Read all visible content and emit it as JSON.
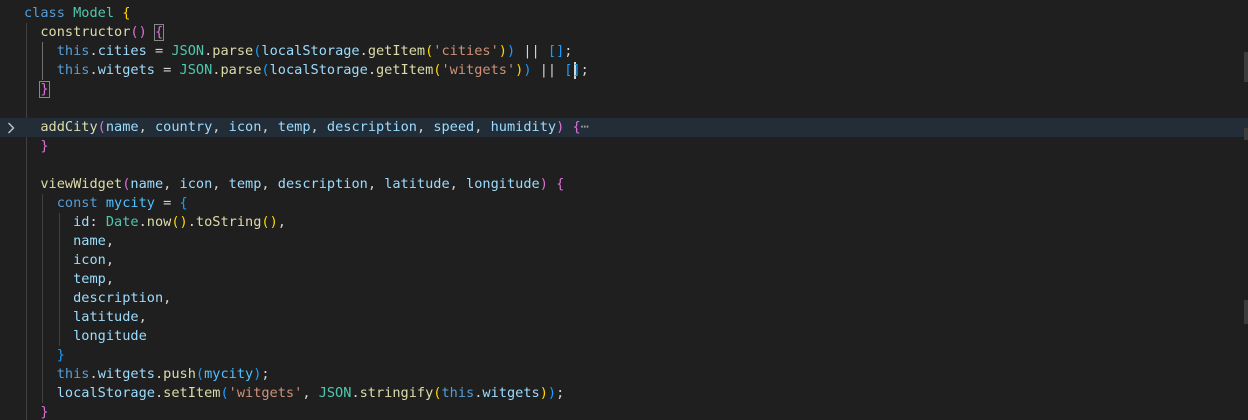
{
  "editor": {
    "colors": {
      "background": "#1f1f1f",
      "current_line": "#232d38",
      "keyword": "#569cd6",
      "class_name": "#4ec9b0",
      "function": "#dcdcaa",
      "variable": "#9cdcfe",
      "string": "#ce9178",
      "text": "#d4d4d4",
      "bracket_gold": "#ffd700",
      "bracket_pink": "#da70d6",
      "bracket_blue": "#179fff"
    },
    "fold_icon": "chevron-right-icon",
    "lines": [
      [
        [
          "class",
          "#569cd6"
        ],
        [
          " ",
          "#d4d4d4"
        ],
        [
          "Model",
          "#4ec9b0"
        ],
        [
          " ",
          "#d4d4d4"
        ],
        [
          "{",
          "#ffd700"
        ]
      ],
      [
        [
          "  ",
          "#d4d4d4"
        ],
        [
          "constructor",
          "#dcdcaa"
        ],
        [
          "()",
          "#da70d6"
        ],
        [
          " ",
          "#d4d4d4"
        ],
        [
          "{",
          "#da70d6"
        ]
      ],
      [
        [
          "    ",
          "#d4d4d4"
        ],
        [
          "this",
          "#569cd6"
        ],
        [
          ".",
          "#d4d4d4"
        ],
        [
          "cities",
          "#9cdcfe"
        ],
        [
          " = ",
          "#d4d4d4"
        ],
        [
          "JSON",
          "#4ec9b0"
        ],
        [
          ".",
          "#d4d4d4"
        ],
        [
          "parse",
          "#dcdcaa"
        ],
        [
          "(",
          "#179fff"
        ],
        [
          "localStorage",
          "#9cdcfe"
        ],
        [
          ".",
          "#d4d4d4"
        ],
        [
          "getItem",
          "#dcdcaa"
        ],
        [
          "(",
          "#ffd700"
        ],
        [
          "'cities'",
          "#ce9178"
        ],
        [
          ")",
          "#ffd700"
        ],
        [
          ")",
          "#179fff"
        ],
        [
          " || ",
          "#d4d4d4"
        ],
        [
          "[]",
          "#179fff"
        ],
        [
          ";",
          "#d4d4d4"
        ]
      ],
      [
        [
          "    ",
          "#d4d4d4"
        ],
        [
          "this",
          "#569cd6"
        ],
        [
          ".",
          "#d4d4d4"
        ],
        [
          "witgets",
          "#9cdcfe"
        ],
        [
          " = ",
          "#d4d4d4"
        ],
        [
          "JSON",
          "#4ec9b0"
        ],
        [
          ".",
          "#d4d4d4"
        ],
        [
          "parse",
          "#dcdcaa"
        ],
        [
          "(",
          "#179fff"
        ],
        [
          "localStorage",
          "#9cdcfe"
        ],
        [
          ".",
          "#d4d4d4"
        ],
        [
          "getItem",
          "#dcdcaa"
        ],
        [
          "(",
          "#ffd700"
        ],
        [
          "'witgets'",
          "#ce9178"
        ],
        [
          ")",
          "#ffd700"
        ],
        [
          ")",
          "#179fff"
        ],
        [
          " || ",
          "#d4d4d4"
        ],
        [
          "[]",
          "#179fff"
        ],
        [
          ";",
          "#d4d4d4"
        ]
      ],
      [
        [
          "  ",
          "#d4d4d4"
        ],
        [
          "}",
          "#da70d6"
        ]
      ],
      [],
      [
        [
          "  ",
          "#d4d4d4"
        ],
        [
          "addCity",
          "#dcdcaa"
        ],
        [
          "(",
          "#da70d6"
        ],
        [
          "name",
          "#9cdcfe"
        ],
        [
          ", ",
          "#d4d4d4"
        ],
        [
          "country",
          "#9cdcfe"
        ],
        [
          ", ",
          "#d4d4d4"
        ],
        [
          "icon",
          "#9cdcfe"
        ],
        [
          ", ",
          "#d4d4d4"
        ],
        [
          "temp",
          "#9cdcfe"
        ],
        [
          ", ",
          "#d4d4d4"
        ],
        [
          "description",
          "#9cdcfe"
        ],
        [
          ", ",
          "#d4d4d4"
        ],
        [
          "speed",
          "#9cdcfe"
        ],
        [
          ", ",
          "#d4d4d4"
        ],
        [
          "humidity",
          "#9cdcfe"
        ],
        [
          ")",
          "#da70d6"
        ],
        [
          " ",
          "#d4d4d4"
        ],
        [
          "{",
          "#da70d6"
        ],
        [
          "⋯",
          "#9d9d9d"
        ]
      ],
      [
        [
          "  ",
          "#d4d4d4"
        ],
        [
          "}",
          "#da70d6"
        ]
      ],
      [],
      [
        [
          "  ",
          "#d4d4d4"
        ],
        [
          "viewWidget",
          "#dcdcaa"
        ],
        [
          "(",
          "#da70d6"
        ],
        [
          "name",
          "#9cdcfe"
        ],
        [
          ", ",
          "#d4d4d4"
        ],
        [
          "icon",
          "#9cdcfe"
        ],
        [
          ", ",
          "#d4d4d4"
        ],
        [
          "temp",
          "#9cdcfe"
        ],
        [
          ", ",
          "#d4d4d4"
        ],
        [
          "description",
          "#9cdcfe"
        ],
        [
          ", ",
          "#d4d4d4"
        ],
        [
          "latitude",
          "#9cdcfe"
        ],
        [
          ", ",
          "#d4d4d4"
        ],
        [
          "longitude",
          "#9cdcfe"
        ],
        [
          ")",
          "#da70d6"
        ],
        [
          " ",
          "#d4d4d4"
        ],
        [
          "{",
          "#da70d6"
        ]
      ],
      [
        [
          "    ",
          "#d4d4d4"
        ],
        [
          "const",
          "#569cd6"
        ],
        [
          " ",
          "#d4d4d4"
        ],
        [
          "mycity",
          "#4fc1ff"
        ],
        [
          " = ",
          "#d4d4d4"
        ],
        [
          "{",
          "#179fff"
        ]
      ],
      [
        [
          "      ",
          "#d4d4d4"
        ],
        [
          "id",
          "#9cdcfe"
        ],
        [
          ": ",
          "#d4d4d4"
        ],
        [
          "Date",
          "#4ec9b0"
        ],
        [
          ".",
          "#d4d4d4"
        ],
        [
          "now",
          "#dcdcaa"
        ],
        [
          "()",
          "#ffd700"
        ],
        [
          ".",
          "#d4d4d4"
        ],
        [
          "toString",
          "#dcdcaa"
        ],
        [
          "()",
          "#ffd700"
        ],
        [
          ",",
          "#d4d4d4"
        ]
      ],
      [
        [
          "      ",
          "#d4d4d4"
        ],
        [
          "name",
          "#9cdcfe"
        ],
        [
          ",",
          "#d4d4d4"
        ]
      ],
      [
        [
          "      ",
          "#d4d4d4"
        ],
        [
          "icon",
          "#9cdcfe"
        ],
        [
          ",",
          "#d4d4d4"
        ]
      ],
      [
        [
          "      ",
          "#d4d4d4"
        ],
        [
          "temp",
          "#9cdcfe"
        ],
        [
          ",",
          "#d4d4d4"
        ]
      ],
      [
        [
          "      ",
          "#d4d4d4"
        ],
        [
          "description",
          "#9cdcfe"
        ],
        [
          ",",
          "#d4d4d4"
        ]
      ],
      [
        [
          "      ",
          "#d4d4d4"
        ],
        [
          "latitude",
          "#9cdcfe"
        ],
        [
          ",",
          "#d4d4d4"
        ]
      ],
      [
        [
          "      ",
          "#d4d4d4"
        ],
        [
          "longitude",
          "#9cdcfe"
        ]
      ],
      [
        [
          "    ",
          "#d4d4d4"
        ],
        [
          "}",
          "#179fff"
        ]
      ],
      [
        [
          "    ",
          "#d4d4d4"
        ],
        [
          "this",
          "#569cd6"
        ],
        [
          ".",
          "#d4d4d4"
        ],
        [
          "witgets",
          "#9cdcfe"
        ],
        [
          ".",
          "#d4d4d4"
        ],
        [
          "push",
          "#dcdcaa"
        ],
        [
          "(",
          "#179fff"
        ],
        [
          "mycity",
          "#4fc1ff"
        ],
        [
          ")",
          "#179fff"
        ],
        [
          ";",
          "#d4d4d4"
        ]
      ],
      [
        [
          "    ",
          "#d4d4d4"
        ],
        [
          "localStorage",
          "#9cdcfe"
        ],
        [
          ".",
          "#d4d4d4"
        ],
        [
          "setItem",
          "#dcdcaa"
        ],
        [
          "(",
          "#179fff"
        ],
        [
          "'witgets'",
          "#ce9178"
        ],
        [
          ", ",
          "#d4d4d4"
        ],
        [
          "JSON",
          "#4ec9b0"
        ],
        [
          ".",
          "#d4d4d4"
        ],
        [
          "stringify",
          "#dcdcaa"
        ],
        [
          "(",
          "#ffd700"
        ],
        [
          "this",
          "#569cd6"
        ],
        [
          ".",
          "#d4d4d4"
        ],
        [
          "witgets",
          "#9cdcfe"
        ],
        [
          ")",
          "#ffd700"
        ],
        [
          ")",
          "#179fff"
        ],
        [
          ";",
          "#d4d4d4"
        ]
      ],
      [
        [
          "  ",
          "#d4d4d4"
        ],
        [
          "}",
          "#da70d6"
        ]
      ]
    ]
  }
}
